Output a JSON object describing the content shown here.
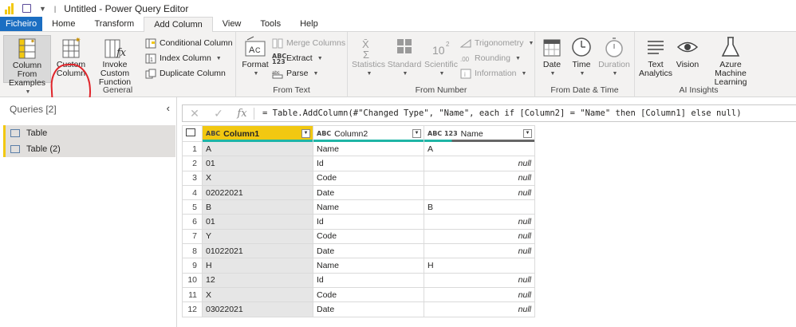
{
  "window": {
    "title": "Untitled - Power Query Editor"
  },
  "tabs": [
    {
      "label": "Ficheiro"
    },
    {
      "label": "Home"
    },
    {
      "label": "Transform"
    },
    {
      "label": "Add Column"
    },
    {
      "label": "View"
    },
    {
      "label": "Tools"
    },
    {
      "label": "Help"
    }
  ],
  "ribbon": {
    "general": {
      "label": "General",
      "col_from_examples": "Column From Examples",
      "custom_column": "Custom Column",
      "invoke_custom_function": "Invoke Custom Function",
      "conditional_column": "Conditional Column",
      "index_column": "Index Column",
      "duplicate_column": "Duplicate Column"
    },
    "from_text": {
      "label": "From Text",
      "format": "Format",
      "merge_columns": "Merge Columns",
      "extract": "Extract",
      "parse": "Parse"
    },
    "from_number": {
      "label": "From Number",
      "statistics": "Statistics",
      "standard": "Standard",
      "scientific": "Scientific",
      "trigonometry": "Trigonometry",
      "rounding": "Rounding",
      "information": "Information"
    },
    "from_date_time": {
      "label": "From Date & Time",
      "date": "Date",
      "time": "Time",
      "duration": "Duration"
    },
    "ai_insights": {
      "label": "AI Insights",
      "text_analytics": "Text Analytics",
      "vision": "Vision",
      "azure_ml": "Azure Machine Learning"
    }
  },
  "queries": {
    "header": "Queries [2]",
    "items": [
      {
        "label": "Table"
      },
      {
        "label": "Table (2)"
      }
    ]
  },
  "formula_bar": {
    "formula": "= Table.AddColumn(#\"Changed Type\", \"Name\", each if [Column2] = \"Name\" then [Column1] else null)"
  },
  "grid": {
    "columns": [
      {
        "type": "ABC",
        "name": "Column1"
      },
      {
        "type": "ABC",
        "name": "Column2"
      },
      {
        "type": "ABC 123",
        "name": "Name"
      }
    ],
    "rows": [
      {
        "n": "1",
        "c1": "A",
        "c2": "Name",
        "c3": "A"
      },
      {
        "n": "2",
        "c1": "01",
        "c2": "Id",
        "c3": "null"
      },
      {
        "n": "3",
        "c1": "X",
        "c2": "Code",
        "c3": "null"
      },
      {
        "n": "4",
        "c1": "02022021",
        "c2": "Date",
        "c3": "null"
      },
      {
        "n": "5",
        "c1": "B",
        "c2": "Name",
        "c3": "B"
      },
      {
        "n": "6",
        "c1": "01",
        "c2": "Id",
        "c3": "null"
      },
      {
        "n": "7",
        "c1": "Y",
        "c2": "Code",
        "c3": "null"
      },
      {
        "n": "8",
        "c1": "01022021",
        "c2": "Date",
        "c3": "null"
      },
      {
        "n": "9",
        "c1": "H",
        "c2": "Name",
        "c3": "H"
      },
      {
        "n": "10",
        "c1": "12",
        "c2": "Id",
        "c3": "null"
      },
      {
        "n": "11",
        "c1": "X",
        "c2": "Code",
        "c3": "null"
      },
      {
        "n": "12",
        "c1": "03022021",
        "c2": "Date",
        "c3": "null"
      }
    ]
  },
  "colors": {
    "accent_yellow": "#f2c811",
    "file_tab_blue": "#1b6ec2",
    "teal_quality": "#1fb5a6",
    "annotation_red": "#e0252b"
  }
}
